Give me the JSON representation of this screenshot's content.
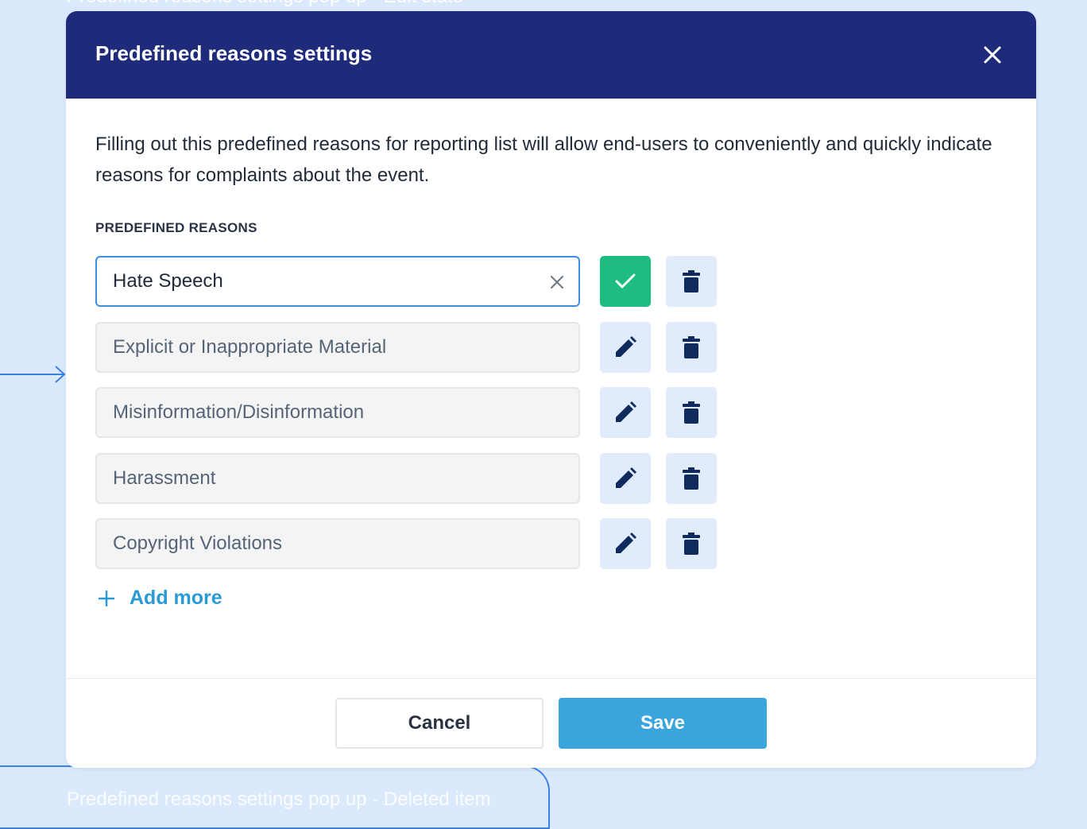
{
  "background": {
    "top_caption": "Predefined reasons settings pop up - Edit state",
    "bottom_caption": "Predefined reasons settings pop up - Deleted item"
  },
  "modal": {
    "title": "Predefined reasons settings",
    "description": "Filling out this predefined reasons for reporting list will allow end-users to conveniently and quickly indicate reasons for complaints about the event.",
    "section_label": "PREDEFINED REASONS",
    "reasons": [
      {
        "value": "Hate Speech",
        "state": "editing"
      },
      {
        "value": "Explicit or Inappropriate Material",
        "state": "readonly"
      },
      {
        "value": "Misinformation/Disinformation",
        "state": "readonly"
      },
      {
        "value": "Harassment",
        "state": "readonly"
      },
      {
        "value": "Copyright Violations",
        "state": "readonly"
      }
    ],
    "add_more_label": "Add more",
    "cancel_label": "Cancel",
    "save_label": "Save"
  },
  "colors": {
    "header_bg": "#1e2a7a",
    "confirm_green": "#1dbd82",
    "save_blue": "#3aa4dd",
    "link_blue": "#2a9ad6",
    "icon_navy": "#0f2a5c"
  },
  "icons": {
    "close": "close-icon",
    "clear": "clear-x-icon",
    "confirm": "checkmark-icon",
    "edit": "pencil-icon",
    "delete": "trash-icon",
    "add": "plus-icon"
  }
}
